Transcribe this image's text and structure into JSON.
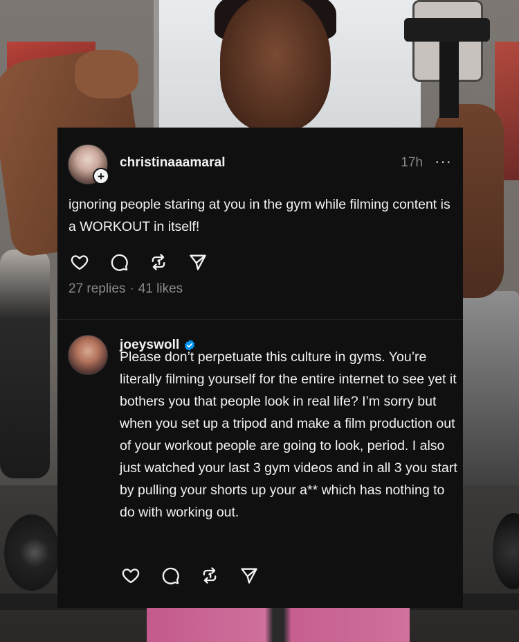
{
  "thread": {
    "post": {
      "username": "christinaaamaral",
      "timestamp": "17h",
      "more": "···",
      "text": "ignoring people staring at you in the gym while filming content is a WORKOUT in itself!",
      "replies": "27 replies",
      "separator": "·",
      "likes": "41 likes"
    },
    "reply": {
      "username": "joeyswoll",
      "verified": true,
      "text": "Please don’t perpetuate this culture in gyms. You’re literally filming yourself for the entire internet to see yet it bothers you that people look in real life? I’m sorry but when you set up a tripod and make a film production out of your workout people are going to look, period. I also just watched your last 3 gym videos and in all 3 you start by pulling your shorts up your a** which has nothing to do with working out."
    }
  },
  "icons": {
    "like": "heart-icon",
    "comment": "comment-icon",
    "repost": "repost-icon",
    "share": "send-icon",
    "verified": "verified-badge-icon",
    "follow": "plus-icon"
  },
  "colors": {
    "card_bg": "#101010",
    "text": "#f3f3f3",
    "muted": "#8a8a8a",
    "verified": "#0095f6"
  }
}
